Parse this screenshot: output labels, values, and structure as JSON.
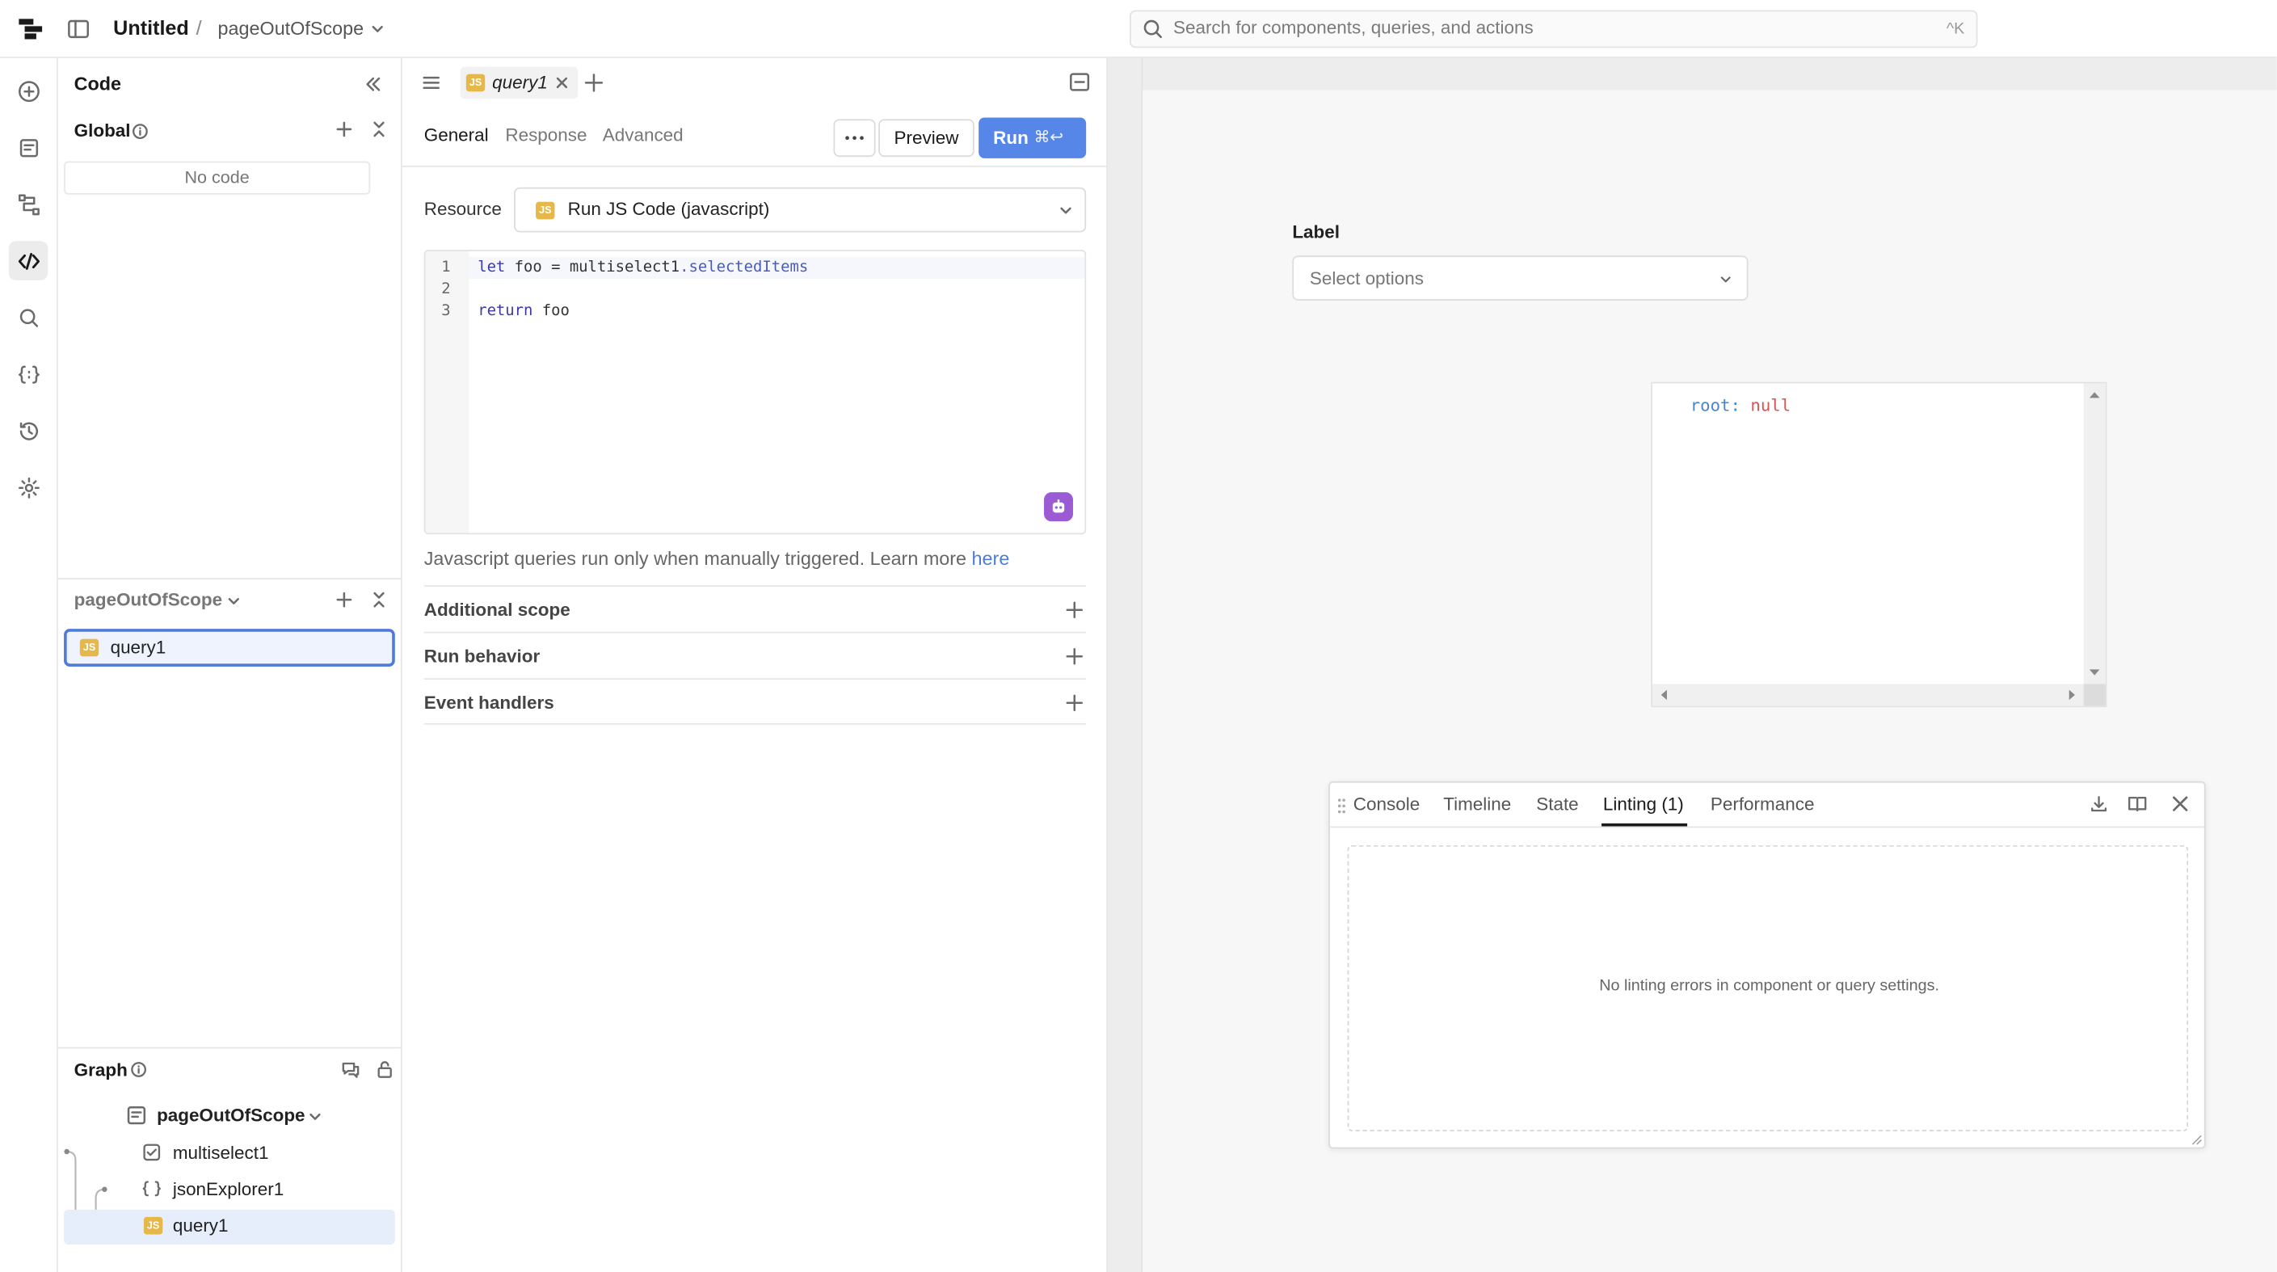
{
  "header": {
    "app_title": "Untitled",
    "separator": "/",
    "page_name": "pageOutOfScope",
    "search_placeholder": "Search for components, queries, and actions",
    "search_shortcut": "^K"
  },
  "rail": {
    "items": [
      "add",
      "pages",
      "graph-routes",
      "code",
      "search",
      "state",
      "history",
      "settings"
    ],
    "active": "code"
  },
  "code_panel": {
    "title": "Code",
    "global_section": "Global",
    "no_code": "No code",
    "page_section": "pageOutOfScope",
    "queries": [
      {
        "label": "query1",
        "type": "JS"
      }
    ],
    "graph": {
      "title": "Graph",
      "root": "pageOutOfScope",
      "nodes": [
        "multiselect1",
        "jsonExplorer1",
        "query1"
      ]
    }
  },
  "editor": {
    "tab_label": "query1",
    "tab_badge": "JS",
    "subtabs": [
      "General",
      "Response",
      "Advanced"
    ],
    "active_subtab": "General",
    "preview_label": "Preview",
    "run_label": "Run",
    "run_shortcut": "⌘↩",
    "resource_label": "Resource",
    "resource_value": "Run JS Code (javascript)",
    "code_lines": [
      {
        "no": "1",
        "text": "let foo = multiselect1.selectedItems"
      },
      {
        "no": "2",
        "text": ""
      },
      {
        "no": "3",
        "text": "return foo"
      }
    ],
    "note_text": "Javascript queries run only when manually triggered. Learn more ",
    "note_link": "here",
    "sections": [
      "Additional scope",
      "Run behavior",
      "Event handlers"
    ]
  },
  "canvas": {
    "multiselect_label": "Label",
    "multiselect_placeholder": "Select options",
    "json_key": "root:",
    "json_value": "null"
  },
  "debug": {
    "tabs": [
      "Console",
      "Timeline",
      "State",
      "Linting (1)",
      "Performance"
    ],
    "active_tab": "Linting (1)",
    "empty_message": "No linting errors in component or query settings."
  },
  "colors": {
    "accent": "#5686e8",
    "selection": "#4f7bd9",
    "js_badge": "#e6b84a",
    "ai_button": "#9a5bd4"
  }
}
